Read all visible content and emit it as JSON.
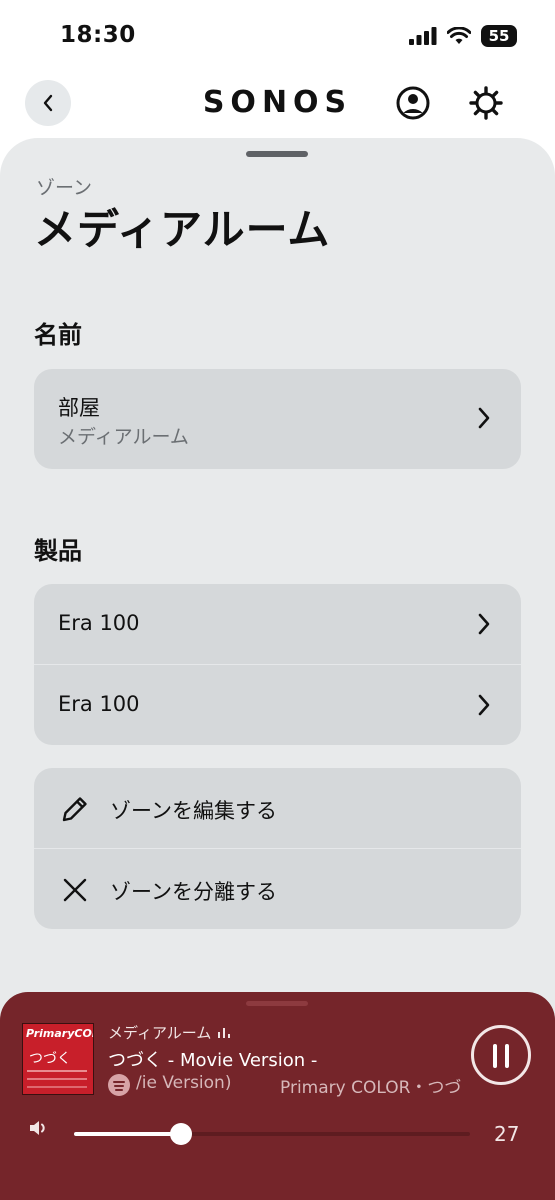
{
  "status_bar": {
    "time": "18:30",
    "battery": "55"
  },
  "header": {
    "logo": "SONOS"
  },
  "zone": {
    "eyebrow": "ゾーン",
    "title": "メディアルーム"
  },
  "name_section": {
    "label": "名前",
    "room_title": "部屋",
    "room_value": "メディアルーム"
  },
  "products_section": {
    "label": "製品",
    "items": [
      {
        "label": "Era 100"
      },
      {
        "label": "Era 100"
      }
    ]
  },
  "actions": [
    {
      "label": "ゾーンを編集する",
      "icon": "pencil-icon"
    },
    {
      "label": "ゾーンを分離する",
      "icon": "close-icon"
    }
  ],
  "now_playing": {
    "room": "メディアルーム",
    "track": "つづく - Movie Version -",
    "album_fragment": "/ie Version)",
    "artist": "Primary COLOR・つづ",
    "art_text_1": "PrimaryCOLOR",
    "art_text_2": "つづく",
    "volume": 27,
    "volume_fraction": 0.27
  },
  "colors": {
    "player_bg": "#75252a",
    "sheet_bg": "#e8eaeb",
    "card_bg": "#d5d8da"
  }
}
